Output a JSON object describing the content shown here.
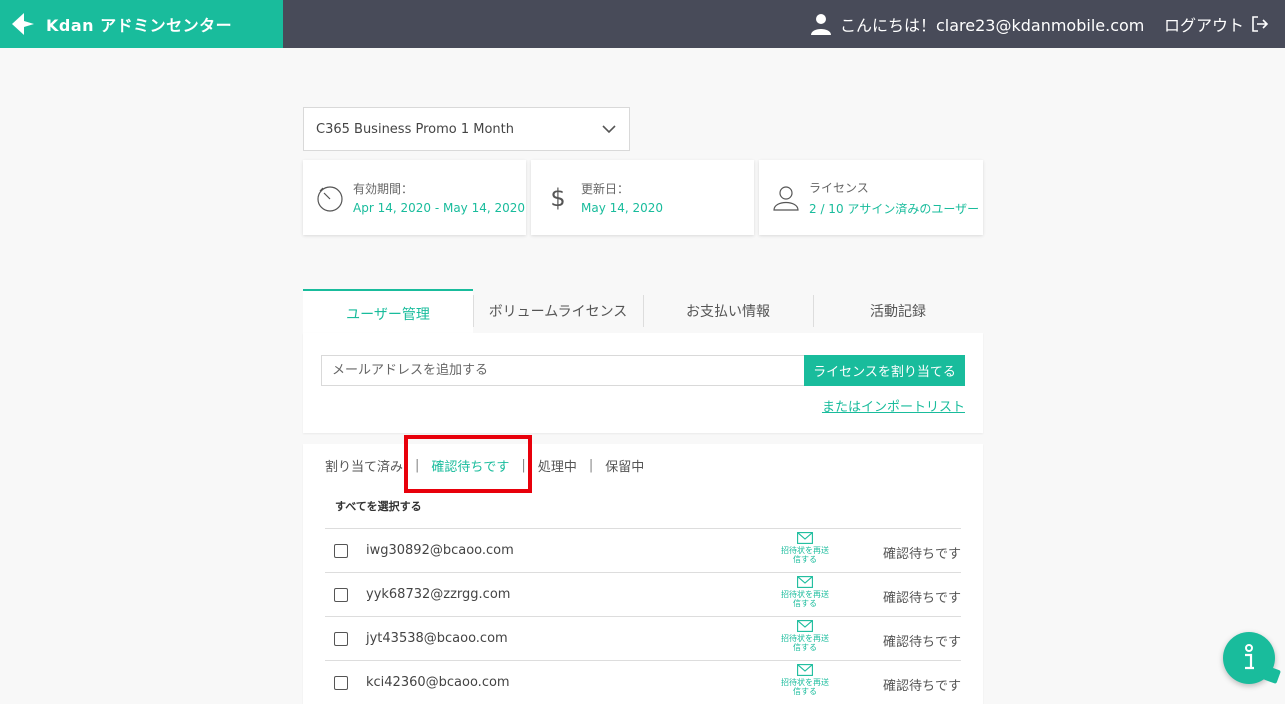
{
  "header": {
    "brand": "Kdan アドミンセンター",
    "greeting": "こんにちは！clare23@kdanmobile.com",
    "logout": "ログアウト"
  },
  "plan": {
    "selected": "C365 Business Promo 1 Month"
  },
  "cards": [
    {
      "icon": "stopwatch-icon",
      "label": "有効期間：",
      "value": "Apr 14, 2020 - May 14, 2020"
    },
    {
      "icon": "dollar-icon",
      "label": "更新日：",
      "value": "May 14, 2020"
    },
    {
      "icon": "user-icon",
      "label": "ライセンス",
      "value": "2 / 10 アサイン済みのユーザー"
    }
  ],
  "tabs": [
    "ユーザー管理",
    "ボリュームライセンス",
    "お支払い情報",
    "活動記録"
  ],
  "add": {
    "placeholder": "メールアドレスを追加する",
    "button": "ライセンスを割り当てる",
    "import_link": "またはインポートリスト"
  },
  "filters": [
    "割り当て済み",
    "確認待ちです",
    "処理中",
    "保留中"
  ],
  "filter_separator": "|",
  "select_all": "すべてを選択する",
  "resend_label": "招待状を再送信する",
  "rows": [
    {
      "email": "iwg30892@bcaoo.com",
      "status": "確認待ちです"
    },
    {
      "email": "yyk68732@zzrgg.com",
      "status": "確認待ちです"
    },
    {
      "email": "jyt43538@bcaoo.com",
      "status": "確認待ちです"
    },
    {
      "email": "kci42360@bcaoo.com",
      "status": "確認待ちです"
    }
  ],
  "colors": {
    "accent": "#19bc9c",
    "header_bg": "#484b59",
    "highlight": "#e8000b"
  }
}
